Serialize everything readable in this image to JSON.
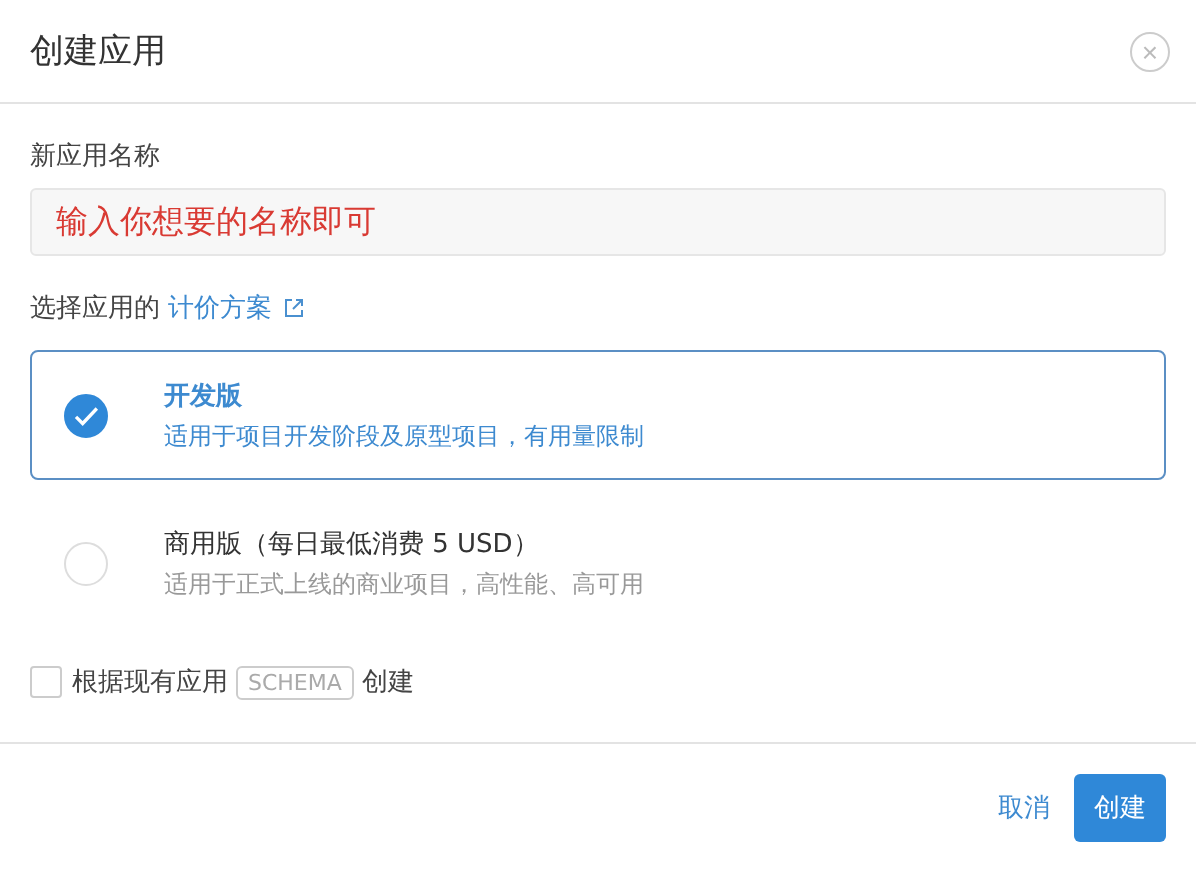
{
  "dialog": {
    "title": "创建应用",
    "close": "×"
  },
  "name_field": {
    "label": "新应用名称",
    "value": "输入你想要的名称即可"
  },
  "pricing": {
    "label": "选择应用的",
    "link": "计价方案"
  },
  "plans": [
    {
      "name": "开发版",
      "description": "适用于项目开发阶段及原型项目，有用量限制",
      "selected": true
    },
    {
      "name": "商用版（每日最低消费 5 USD）",
      "description": "适用于正式上线的商业项目，高性能、高可用",
      "selected": false
    }
  ],
  "schema_option": {
    "label": "根据现有应用",
    "tag": "SCHEMA",
    "suffix": "创建",
    "checked": false
  },
  "buttons": [
    {
      "label": "取消",
      "kind": "link"
    },
    {
      "label": "创建",
      "kind": "primary"
    }
  ]
}
